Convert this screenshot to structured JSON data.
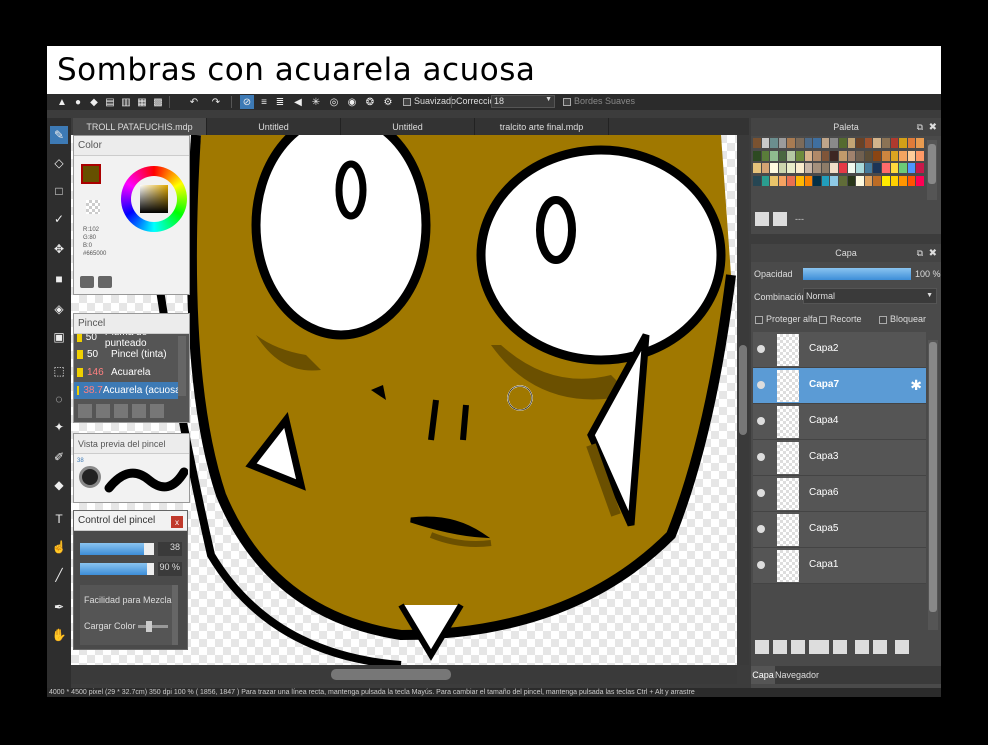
{
  "banner": {
    "title": "Sombras con acuarela acuosa"
  },
  "topbar": {
    "smoothing_label": "Suavizado",
    "correction_label": "Corrección",
    "correction_value": "18",
    "soft_edges_label": "Bordes Suaves"
  },
  "tabs": [
    {
      "label": "TROLL PATAFUCHIS.mdp"
    },
    {
      "label": "Untitled"
    },
    {
      "label": "Untitled"
    },
    {
      "label": "tralcito arte final.mdp"
    }
  ],
  "color_panel": {
    "title": "Color",
    "r": "R:102",
    "g": "G:80",
    "b": "B:0",
    "hex": "#665000",
    "current_color": "#665000"
  },
  "brush_panel": {
    "title": "Pincel",
    "items": [
      {
        "size": "50",
        "name": "Pluma de punteado",
        "chip": "#f0d000"
      },
      {
        "size": "50",
        "name": "Pincel (tinta)",
        "chip": "#f0d000"
      },
      {
        "size": "146",
        "name": "Acuarela",
        "chip": "#f0d000"
      },
      {
        "size": "38.7",
        "name": "Acuarela (acuosa)",
        "chip": "#f0d000"
      }
    ]
  },
  "brush_preview": {
    "title": "Vista previa del pincel",
    "size_label": "38"
  },
  "brush_control": {
    "title": "Control del pincel",
    "size_value": "38",
    "size_level": 0.86,
    "opacity_value": "90 %",
    "opacity_level": 0.9,
    "blend_label": "Facilidad para Mezclar Co",
    "load_label": "Cargar Color",
    "close_label": "x"
  },
  "palette_panel": {
    "title": "Paleta",
    "extra_label": "---",
    "colors": [
      "#7a5230",
      "#c9c9c9",
      "#6b8e8e",
      "#9b9b9b",
      "#a87b52",
      "#7c6b5a",
      "#4d6b8a",
      "#3f6f9f",
      "#bfa58a",
      "#8a8a8a",
      "#556b2f",
      "#c4a574",
      "#6b4226",
      "#a0522d",
      "#d2b48c",
      "#8b7355",
      "#b03a2e",
      "#d4a017",
      "#e07b39",
      "#e89b50",
      "#2d4a22",
      "#5a7d3a",
      "#8fbc8f",
      "#4a6741",
      "#b5c7a3",
      "#6e8b3d",
      "#d9b38c",
      "#b08968",
      "#7f5539",
      "#3e2723",
      "#c19a6b",
      "#a0826d",
      "#706050",
      "#5d4e37",
      "#8b4513",
      "#cd853f",
      "#daa520",
      "#f4a460",
      "#ffcc99",
      "#ff9966",
      "#e6c27a",
      "#d4a373",
      "#fefae0",
      "#ccd5ae",
      "#e9edc9",
      "#faedcd",
      "#c8b6a6",
      "#a4907c",
      "#8d7b68",
      "#f1dec9",
      "#e63946",
      "#f1faee",
      "#a8dadc",
      "#457b9d",
      "#1d3557",
      "#ff6b6b",
      "#ffd93d",
      "#6bcb77",
      "#4d96ff",
      "#c9184a",
      "#264653",
      "#2a9d8f",
      "#e9c46a",
      "#f4a261",
      "#e76f51",
      "#ffb703",
      "#fb8500",
      "#023047",
      "#219ebc",
      "#8ecae6",
      "#606c38",
      "#283618",
      "#fefae0",
      "#dda15e",
      "#bc6c25",
      "#ffea00",
      "#ffd000",
      "#ff9500",
      "#ff5400",
      "#ff0054"
    ]
  },
  "layer_panel": {
    "title": "Capa",
    "opacity_label": "Opacidad",
    "opacity_value": "100 %",
    "opacity_level": 1.0,
    "blend_label": "Combinación",
    "blend_value": "Normal",
    "protect_alpha_label": "Proteger alfa",
    "clip_label": "Recorte",
    "lock_label": "Bloquear",
    "layers": [
      {
        "name": "Capa2",
        "active": false
      },
      {
        "name": "Capa7",
        "active": true
      },
      {
        "name": "Capa4",
        "active": false
      },
      {
        "name": "Capa3",
        "active": false
      },
      {
        "name": "Capa6",
        "active": false
      },
      {
        "name": "Capa5",
        "active": false
      },
      {
        "name": "Capa1",
        "active": false
      }
    ],
    "bottom_tabs": [
      "Capa",
      "Navegador"
    ]
  },
  "status_bar": {
    "text": "4000 * 4500 pixel   (29 * 32.7cm)   350 dpi   100 %   ( 1856, 1847 )   Para trazar una línea recta, mantenga pulsada la tecla Mayús. Para cambiar el tamaño del pincel, mantenga pulsada las teclas Ctrl + Alt y arrastre"
  },
  "colors": {
    "accent": "#3d7ab5",
    "ochre": "#a07800",
    "layer_active": "#5b9bd5"
  }
}
